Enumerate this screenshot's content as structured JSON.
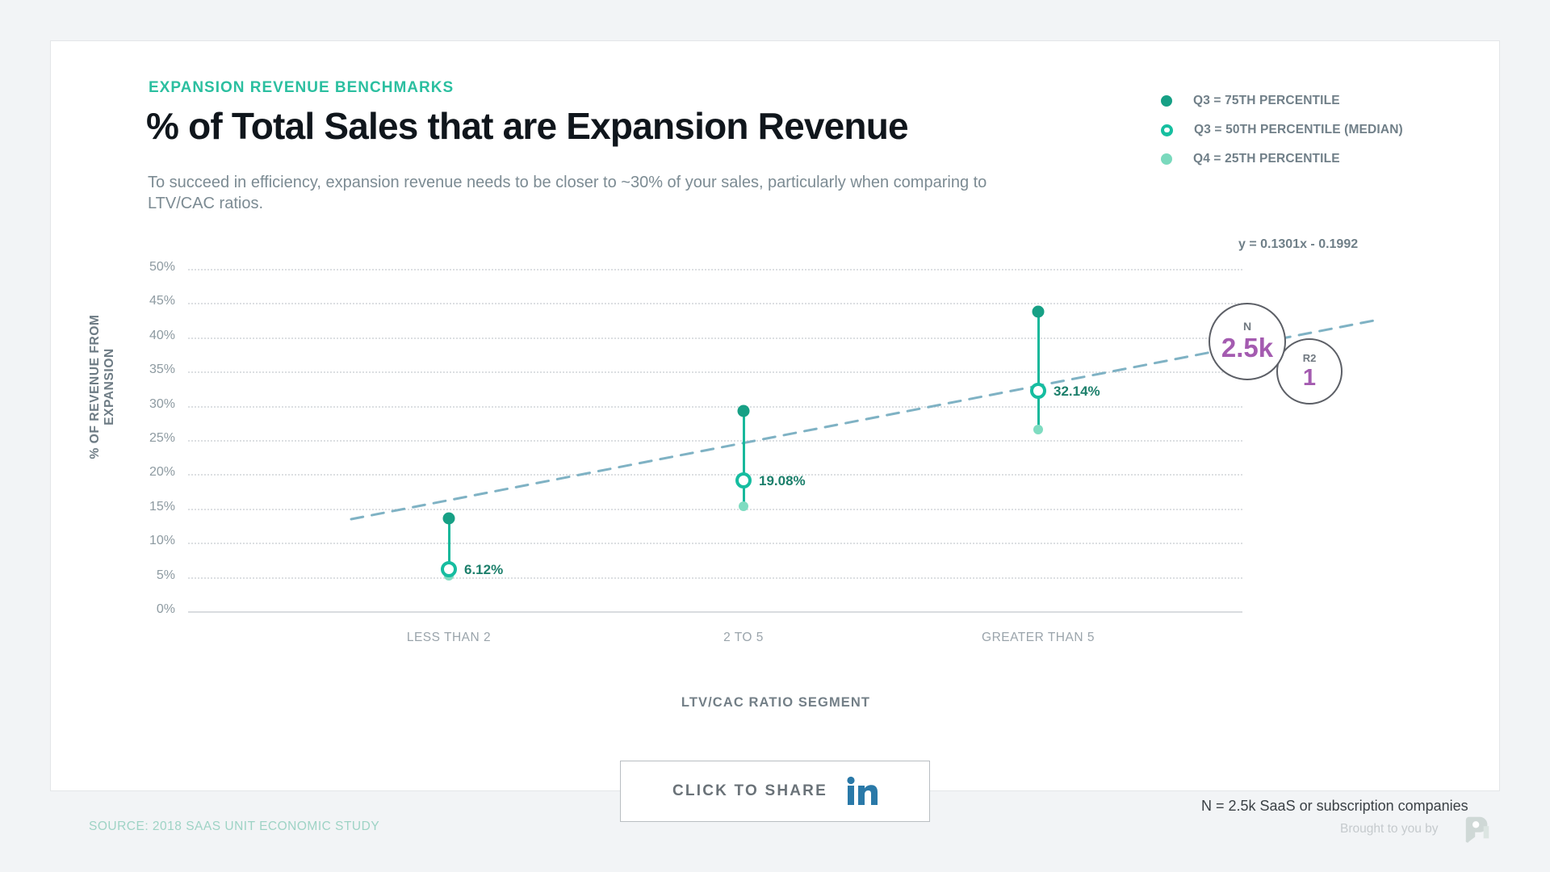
{
  "header": {
    "eyebrow": "EXPANSION REVENUE BENCHMARKS",
    "headline": "% of Total Sales that are Expansion Revenue",
    "subhead": "To succeed in efficiency, expansion revenue needs to be closer to ~30% of your sales, particularly when comparing to LTV/CAC ratios."
  },
  "legend": {
    "items": [
      {
        "label": "Q3 = 75TH PERCENTILE",
        "marker": "solid-dark",
        "color": "#16a085"
      },
      {
        "label": "Q3 = 50TH PERCENTILE (MEDIAN)",
        "marker": "ring",
        "color": "#16bfa0"
      },
      {
        "label": "Q4 = 25TH PERCENTILE",
        "marker": "solid-light",
        "color": "#7ad9bd"
      }
    ],
    "equation": "y = 0.1301x - 0.1992"
  },
  "stats": {
    "n": {
      "key": "N",
      "value": "2.5k"
    },
    "r2": {
      "key": "R2",
      "value": "1"
    }
  },
  "footer": {
    "share_label": "CLICK TO SHARE",
    "share_icon": "linkedin-icon",
    "footnote": "N = 2.5k SaaS or subscription companies",
    "source": "SOURCE: 2018 SAAS UNIT ECONOMIC STUDY",
    "brought": "Brought to you by",
    "brand_icon": "profitwell-logo-icon"
  },
  "chart_data": {
    "type": "scatter",
    "title": "% of Total Sales that are Expansion Revenue",
    "xlabel": "LTV/CAC RATIO SEGMENT",
    "ylabel": "% OF REVENUE FROM EXPANSION",
    "categories": [
      "LESS THAN 2",
      "2 TO 5",
      "GREATER THAN 5"
    ],
    "ylim": [
      0,
      50
    ],
    "ytick_labels": [
      "50%",
      "45%",
      "40%",
      "35%",
      "30%",
      "25%",
      "20%",
      "15%",
      "10%",
      "5%",
      "0%"
    ],
    "ytick_values": [
      50,
      45,
      40,
      35,
      30,
      25,
      20,
      15,
      10,
      5,
      0
    ],
    "grid": true,
    "legend_position": "top-right",
    "series": [
      {
        "name": "Q3 = 75TH PERCENTILE",
        "color": "#17a085",
        "values": [
          13.6,
          29.3,
          43.8
        ]
      },
      {
        "name": "Q3 = 50TH PERCENTILE (MEDIAN)",
        "color": "#16bda0",
        "values": [
          6.12,
          19.08,
          32.14
        ],
        "labels": [
          "6.12%",
          "19.08%",
          "32.14%"
        ]
      },
      {
        "name": "Q4 = 25TH PERCENTILE",
        "color": "#7fdcc1",
        "values": [
          5.2,
          15.3,
          26.5
        ]
      }
    ],
    "trendline": {
      "equation": "y = 0.1301x - 0.1992",
      "style": "dashed",
      "color": "#7fb2c4",
      "r2": "1",
      "n": "2.5k"
    },
    "annotations": [
      "N = 2.5k SaaS or subscription companies"
    ]
  }
}
